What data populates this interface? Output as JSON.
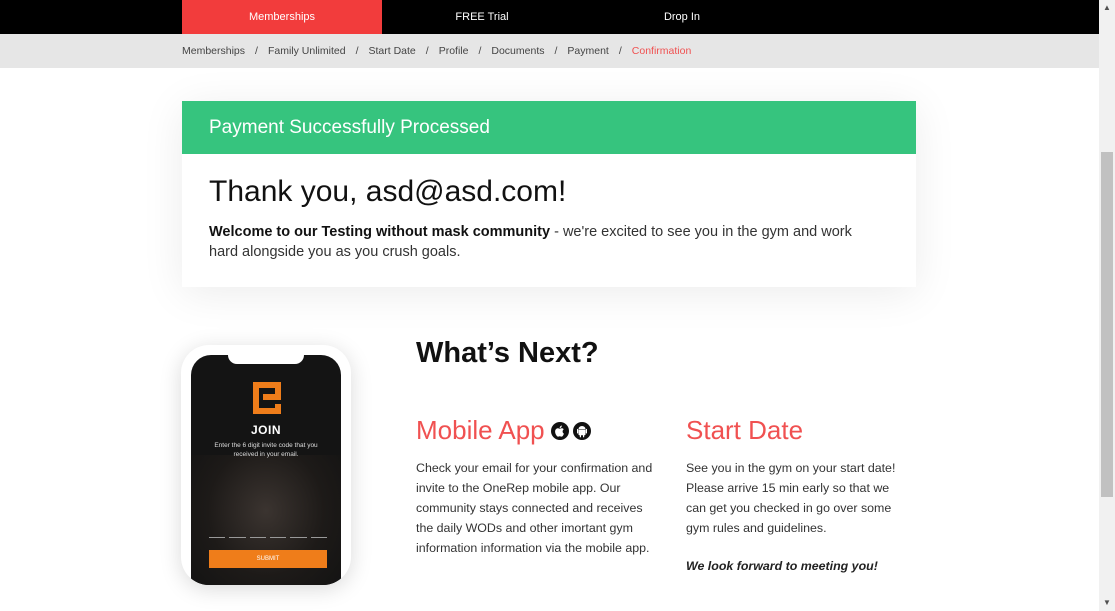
{
  "nav": {
    "tabs": [
      {
        "label": "Memberships",
        "active": true
      },
      {
        "label": "FREE Trial",
        "active": false
      },
      {
        "label": "Drop In",
        "active": false
      }
    ]
  },
  "breadcrumb": {
    "items": [
      "Memberships",
      "Family Unlimited",
      "Start Date",
      "Profile",
      "Documents",
      "Payment",
      "Confirmation"
    ],
    "separator": "/",
    "current_index": 6
  },
  "success": {
    "banner": "Payment Successfully Processed",
    "thanks": "Thank you, asd@asd.com!",
    "welcome_bold": "Welcome to our Testing without mask community",
    "welcome_rest": " - we're excited to see you in the gym and work hard alongside you as you crush goals."
  },
  "phone": {
    "join_label": "JOIN",
    "join_sub": "Enter the 6 digit invite code that you received in your email.",
    "submit_label": "SUBMIT"
  },
  "next": {
    "title": "What’s Next?",
    "mobile_app": {
      "title": "Mobile App",
      "icons": [
        "apple-icon",
        "android-icon"
      ],
      "text": "Check your email for your confirmation and invite to the OneRep mobile app. Our community stays connected and receives the daily WODs and other imortant gym information information via the mobile app."
    },
    "start_date": {
      "title": "Start Date",
      "text": "See you in the gym on your start date! Please arrive 15 min early so that we can get you checked in go over some gym rules and guidelines.",
      "closing": "We look forward to meeting you!"
    }
  },
  "colors": {
    "accent": "#f23c3c",
    "success": "#36c47e",
    "orange": "#ef7d1a"
  }
}
